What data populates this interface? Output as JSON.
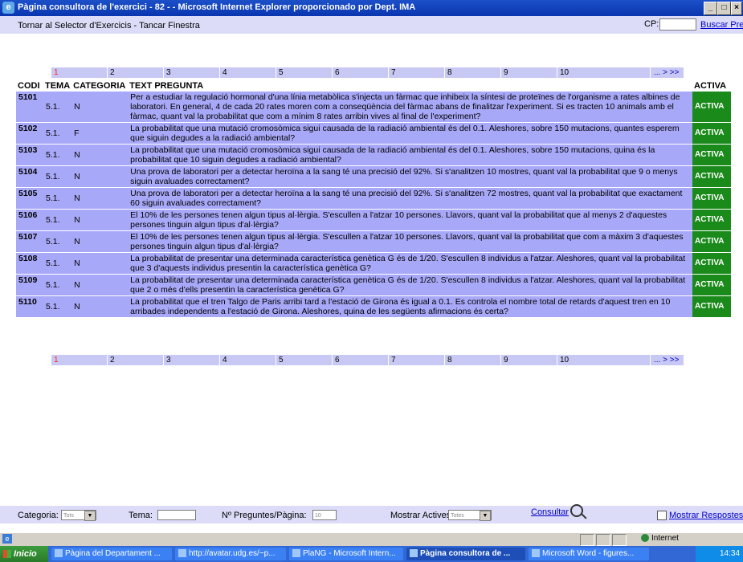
{
  "window": {
    "title": "Pàgina consultora de l'exercici - 82 - - Microsoft Internet Explorer proporcionado por Dept. IMA",
    "min": "_",
    "max": "□",
    "close": "×"
  },
  "topbar": {
    "tornar": "Tornar al Selector d'Exercicis",
    "separator": " - ",
    "tancar": "Tancar Finestra",
    "cp_label": "CP:",
    "buscar": "Buscar Pregunta"
  },
  "pager": {
    "pages": [
      "1",
      "2",
      "3",
      "4",
      "5",
      "6",
      "7",
      "8",
      "9",
      "10"
    ],
    "current": "1",
    "more": "... > >>"
  },
  "table": {
    "headers": [
      "CODI",
      "TEMA",
      "CATEGORIA",
      "TEXT PREGUNTA",
      "ACTIVA"
    ],
    "rows": [
      {
        "codi": "5101",
        "tema": "5.1.",
        "cat": "N",
        "text": "Per a estudiar la regulació hormonal d'una línia metabòlica s'injecta un fàrmac que inhibeix la síntesi de proteïnes de l'organisme a rates albines de laboratori. En general, 4 de cada 20 rates moren com a conseqüència del fàrmac abans de finalitzar l'experiment. Si es tracten 10 animals amb el fàrmac, quant val la probabilitat que com a mínim 8 rates arribin vives al final de l'experiment?",
        "activa": "ACTIVA"
      },
      {
        "codi": "5102",
        "tema": "5.1.",
        "cat": "F",
        "text": "La probabilitat que una mutació cromosòmica sigui causada de la radiació ambiental és del 0.1. Aleshores, sobre 150 mutacions, quantes esperem que siguin degudes a la radiació ambiental?",
        "activa": "ACTIVA"
      },
      {
        "codi": "5103",
        "tema": "5.1.",
        "cat": "N",
        "text": "La probabilitat que una mutació cromosòmica sigui causada de la radiació ambiental és del 0.1. Aleshores, sobre 150 mutacions, quina és la probabilitat que 10 siguin degudes a radiació ambiental?",
        "activa": "ACTIVA"
      },
      {
        "codi": "5104",
        "tema": "5.1.",
        "cat": "N",
        "text": "Una prova de laboratori per a detectar heroïna a la sang té una precisió del 92%. Si s'analitzen 10 mostres, quant val la probabilitat que 9 o menys siguin avaluades correctament?",
        "activa": "ACTIVA"
      },
      {
        "codi": "5105",
        "tema": "5.1.",
        "cat": "N",
        "text": "Una prova de laboratori per a detectar heroïna a la sang té una precisió del 92%. Si s'analitzen 72 mostres, quant val la probabilitat que exactament 60 siguin avaluades correctament?",
        "activa": "ACTIVA"
      },
      {
        "codi": "5106",
        "tema": "5.1.",
        "cat": "N",
        "text": "El 10% de les persones tenen algun tipus al·lèrgia. S'escullen a l'atzar 10 persones. Llavors, quant val la probabilitat que al menys 2 d'aquestes persones tinguin algun tipus d'al·lèrgia?",
        "activa": "ACTIVA"
      },
      {
        "codi": "5107",
        "tema": "5.1.",
        "cat": "N",
        "text": "El 10% de les persones tenen algun tipus al·lèrgia. S'escullen a l'atzar 10 persones. Llavors, quant val la probabilitat que com a màxim 3 d'aquestes persones tinguin algun tipus d'al·lèrgia?",
        "activa": "ACTIVA"
      },
      {
        "codi": "5108",
        "tema": "5.1.",
        "cat": "N",
        "text": "La probabilitat de presentar una determinada característica genètica G és de 1/20. S'escullen 8 individus a l'atzar. Aleshores, quant val la probabilitat que 3 d'aquests individus presentin la característica genètica G?",
        "activa": "ACTIVA"
      },
      {
        "codi": "5109",
        "tema": "5.1.",
        "cat": "N",
        "text": "La probabilitat de presentar una determinada característica genètica G és de 1/20. S'escullen 8 individus a l'atzar. Aleshores, quant val la probabilitat que 2 o més d'ells presentin la característica genètica G?",
        "activa": "ACTIVA"
      },
      {
        "codi": "5110",
        "tema": "5.1.",
        "cat": "N",
        "text": "La probabilitat que el tren Talgo de Paris arribi tard a l'estació de Girona és igual a 0.1. Es controla el nombre total de retards d'aquest tren en 10 arribades independents a l'estació de Girona. Aleshores, quina de les següents afirmacions és certa?",
        "activa": "ACTIVA"
      }
    ]
  },
  "filters": {
    "categoria_label": "Categoria:",
    "categoria_value": "Tots",
    "tema_label": "Tema:",
    "npreg_label": "Nº Preguntes/Pàgina:",
    "npreg_value": "10",
    "activas_label": "Mostrar Actives:",
    "activas_value": "Totes",
    "consultar": "Consultar",
    "mostrar": "Mostrar Respostes"
  },
  "status": {
    "zone": "Internet"
  },
  "taskbar": {
    "start": "Inicio",
    "tasks": [
      "Pàgina del Departament ...",
      "http://avatar.udg.es/~p...",
      "PlaNG - Microsoft Intern...",
      "Pàgina consultora de ...",
      "Microsoft Word - figures..."
    ],
    "clock": "14:34"
  }
}
